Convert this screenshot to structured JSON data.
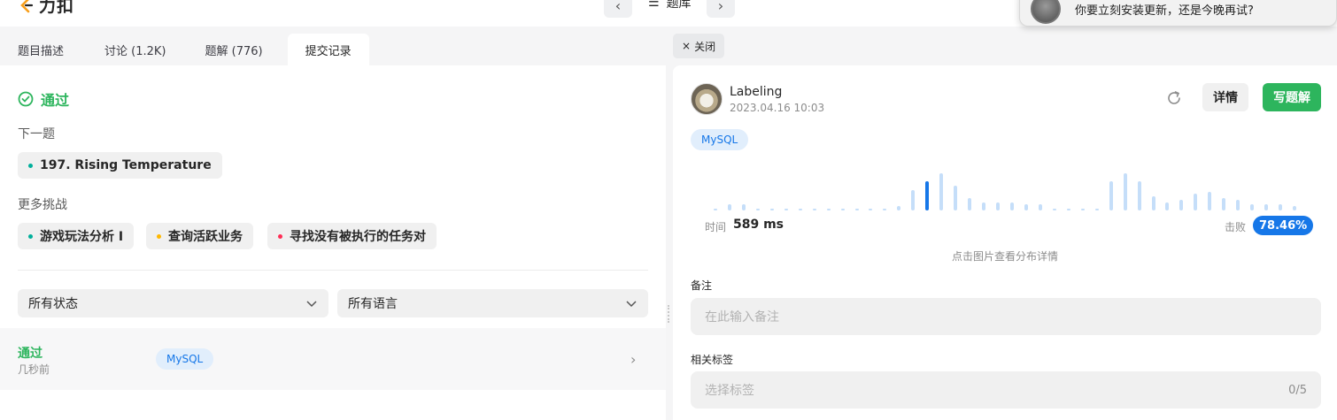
{
  "header": {
    "logo_text": "力扣",
    "prev_icon": "chevron-left-icon",
    "next_icon": "chevron-right-icon",
    "list_icon": "list-icon",
    "problem_bank_label": "题库"
  },
  "notification": {
    "text": "你要立刻安装更新，还是今晚再试?"
  },
  "tabs": [
    {
      "label": "题目描述"
    },
    {
      "label": "讨论 (1.2K)"
    },
    {
      "label": "题解 (776)"
    },
    {
      "label": "提交记录"
    }
  ],
  "left": {
    "status": "通过",
    "next_label": "下一题",
    "next_problem": "197. Rising Temperature",
    "more_label": "更多挑战",
    "challenges": [
      {
        "label": "游戏玩法分析 I",
        "color": "#00af9b"
      },
      {
        "label": "查询活跃业务",
        "color": "#ffb800"
      },
      {
        "label": "寻找没有被执行的任务对",
        "color": "#ff2d55"
      }
    ],
    "filter_status": "所有状态",
    "filter_language": "所有语言",
    "submission": {
      "status": "通过",
      "time": "几秒前",
      "language": "MySQL"
    }
  },
  "right": {
    "close_label": "关闭",
    "user_name": "Labeling",
    "submit_date": "2023.04.16 10:03",
    "detail_label": "详情",
    "write_solution_label": "写题解",
    "language_tag": "MySQL",
    "runtime_label": "时间",
    "runtime_value": "589 ms",
    "beats_label": "击败",
    "beats_value": "78.46%",
    "chart_hint": "点击图片查看分布详情",
    "note_label": "备注",
    "note_placeholder": "在此输入备注",
    "tags_label": "相关标签",
    "tags_placeholder": "选择标签",
    "tags_count": "0/5"
  },
  "colors": {
    "accent_green": "#2db55d",
    "accent_blue": "#1677e8",
    "bar_light": "#c5def9"
  },
  "chart_data": {
    "type": "bar",
    "values": [
      1,
      3,
      3,
      1,
      1,
      1,
      1,
      1,
      1,
      1,
      1,
      1,
      1,
      2,
      10,
      14,
      18,
      12,
      6,
      4,
      4,
      4,
      3,
      3,
      1,
      1,
      1,
      1,
      14,
      18,
      14,
      7,
      4,
      5,
      8,
      9,
      6,
      5,
      3,
      3,
      3,
      2
    ],
    "highlight_index": 15
  }
}
